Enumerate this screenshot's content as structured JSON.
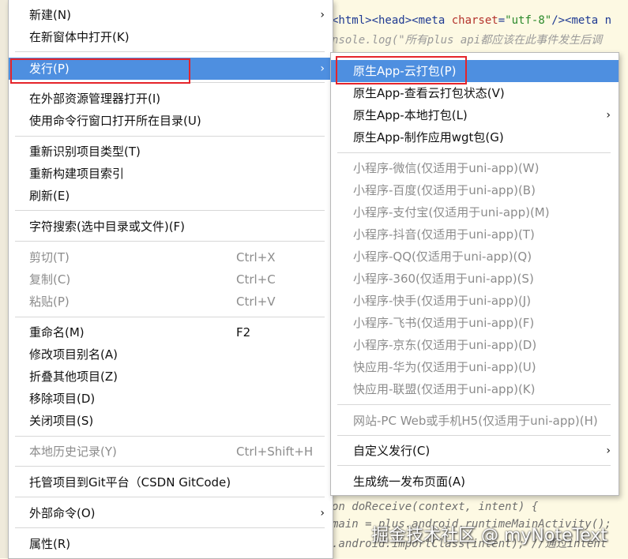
{
  "editor": {
    "line0_tag": "<html><head><meta ",
    "line0_attr": "charset",
    "line0_eq": "=",
    "line0_val": "\"utf-8\"",
    "line0_tail": "/><meta n",
    "line1": "nsole.log(\"所有plus api都应该在此事件发生后调",
    "bottom1": "on doReceive(context, intent) {",
    "bottom2": "main = plus.android.runtimeMainActivity();",
    "bottom3": ".android.importClass(intent); //通过intent"
  },
  "watermark": "掘金技术社区 @ myNoteText",
  "main_menu": {
    "new": {
      "label": "新建(N)",
      "arrow": "›"
    },
    "open_new_window": {
      "label": "在新窗体中打开(K)"
    },
    "publish": {
      "label": "发行(P)",
      "arrow": "›"
    },
    "open_explorer": {
      "label": "在外部资源管理器打开(I)"
    },
    "open_cmd": {
      "label": "使用命令行窗口打开所在目录(U)"
    },
    "reidentify": {
      "label": "重新识别项目类型(T)"
    },
    "rebuild_index": {
      "label": "重新构建项目索引"
    },
    "refresh": {
      "label": "刷新(E)"
    },
    "char_search": {
      "label": "字符搜索(选中目录或文件)(F)"
    },
    "cut": {
      "label": "剪切(T)",
      "shortcut": "Ctrl+X"
    },
    "copy": {
      "label": "复制(C)",
      "shortcut": "Ctrl+C"
    },
    "paste": {
      "label": "粘贴(P)",
      "shortcut": "Ctrl+V"
    },
    "rename": {
      "label": "重命名(M)",
      "shortcut": "F2"
    },
    "alias": {
      "label": "修改项目别名(A)"
    },
    "collapse_others": {
      "label": "折叠其他项目(Z)"
    },
    "remove": {
      "label": "移除项目(D)"
    },
    "close": {
      "label": "关闭项目(S)"
    },
    "local_history": {
      "label": "本地历史记录(Y)",
      "shortcut": "Ctrl+Shift+H"
    },
    "host_git": {
      "label": "托管项目到Git平台（CSDN GitCode)"
    },
    "external_cmd": {
      "label": "外部命令(O)",
      "arrow": "›"
    },
    "properties": {
      "label": "属性(R)"
    }
  },
  "sub_menu": {
    "cloud_pack": {
      "label": "原生App-云打包(P)"
    },
    "cloud_status": {
      "label": "原生App-查看云打包状态(V)"
    },
    "local_pack": {
      "label": "原生App-本地打包(L)",
      "arrow": "›"
    },
    "wgt_pack": {
      "label": "原生App-制作应用wgt包(G)"
    },
    "mp_weixin": {
      "label": "小程序-微信(仅适用于uni-app)(W)"
    },
    "mp_baidu": {
      "label": "小程序-百度(仅适用于uni-app)(B)"
    },
    "mp_alipay": {
      "label": "小程序-支付宝(仅适用于uni-app)(M)"
    },
    "mp_douyin": {
      "label": "小程序-抖音(仅适用于uni-app)(T)"
    },
    "mp_qq": {
      "label": "小程序-QQ(仅适用于uni-app)(Q)"
    },
    "mp_360": {
      "label": "小程序-360(仅适用于uni-app)(S)"
    },
    "mp_kuaishou": {
      "label": "小程序-快手(仅适用于uni-app)(J)"
    },
    "mp_feishu": {
      "label": "小程序-飞书(仅适用于uni-app)(F)"
    },
    "mp_jd": {
      "label": "小程序-京东(仅适用于uni-app)(D)"
    },
    "qa_huawei": {
      "label": "快应用-华为(仅适用于uni-app)(U)"
    },
    "qa_union": {
      "label": "快应用-联盟(仅适用于uni-app)(K)"
    },
    "web_h5": {
      "label": "网站-PC Web或手机H5(仅适用于uni-app)(H)"
    },
    "custom": {
      "label": "自定义发行(C)",
      "arrow": "›"
    },
    "unified_page": {
      "label": "生成统一发布页面(A)"
    }
  },
  "colors": {
    "highlight": "#4e8fe0",
    "annotation": "#e5242a",
    "disabled_text": "#8c8c8c"
  }
}
